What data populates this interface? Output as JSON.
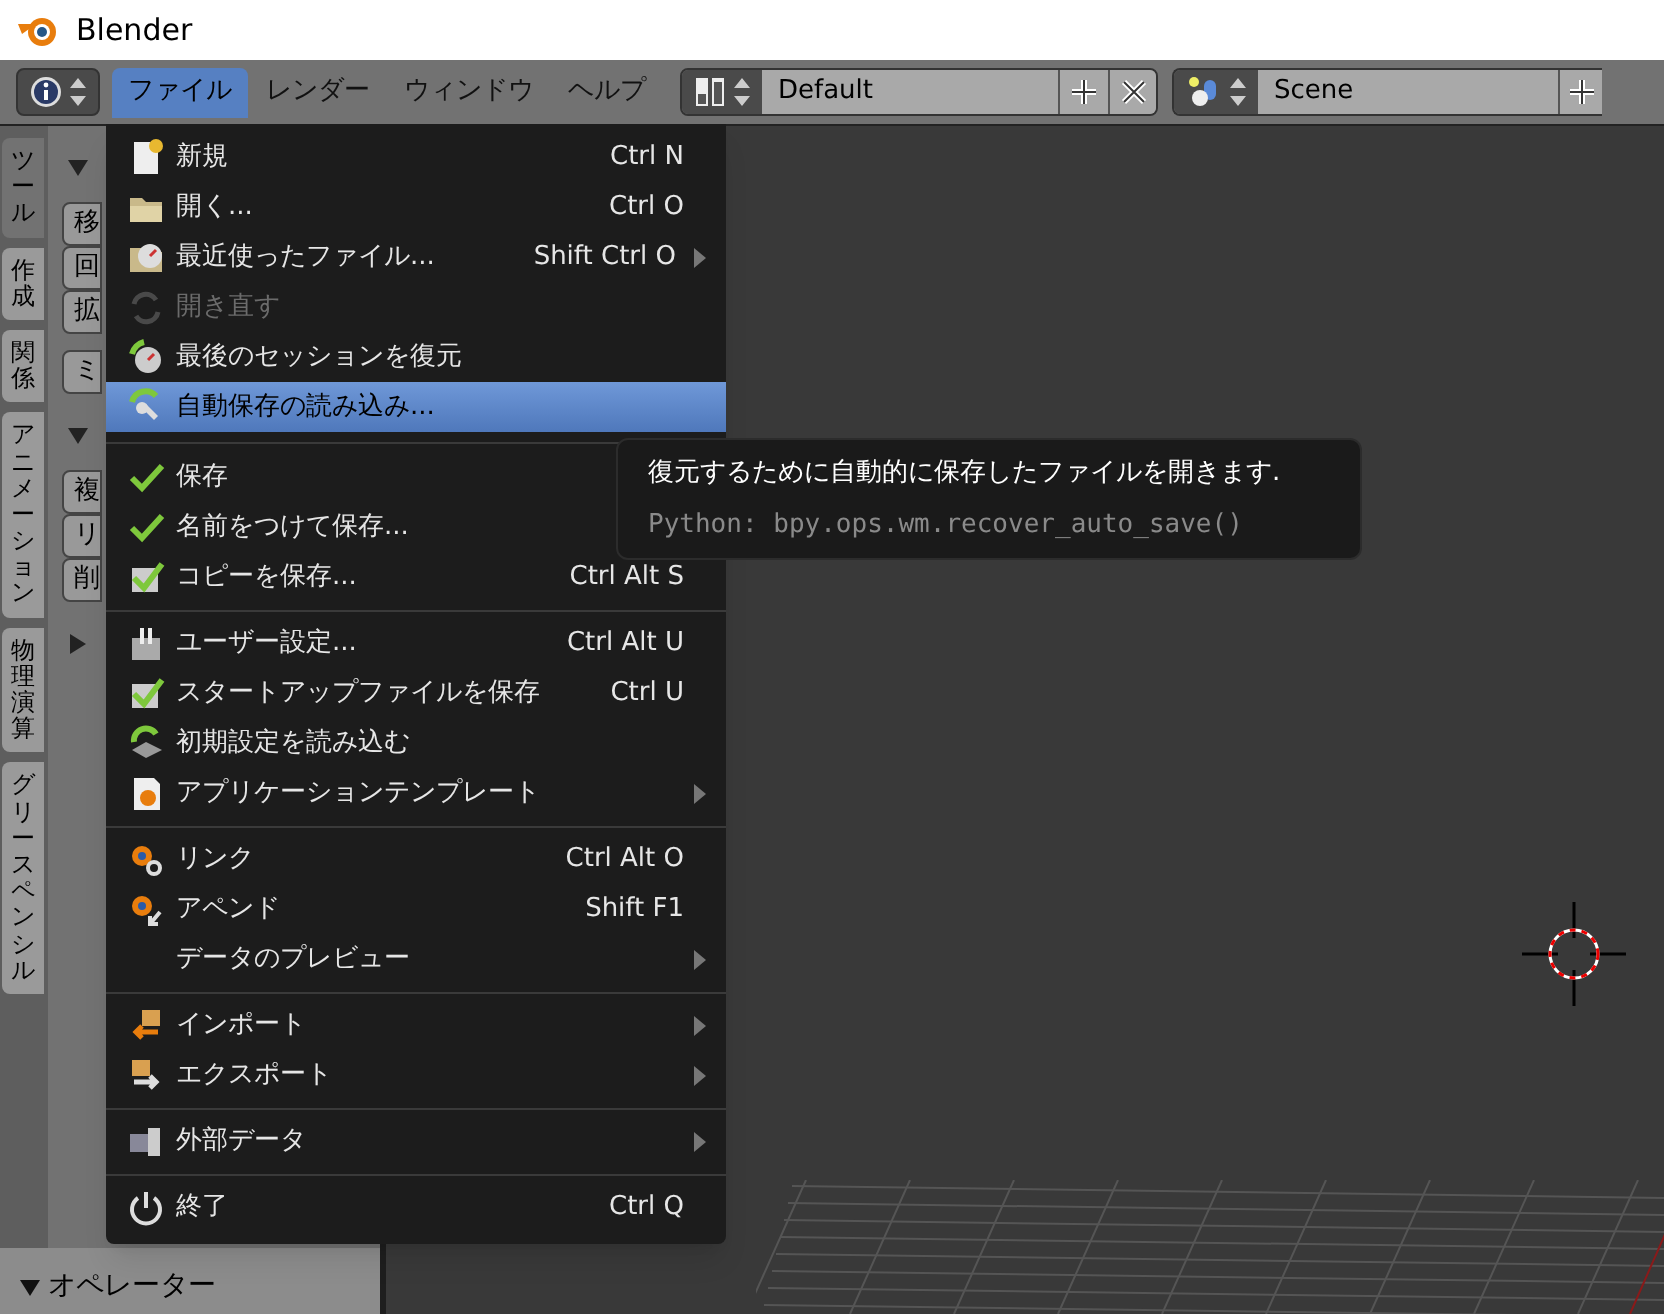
{
  "window": {
    "title": "Blender"
  },
  "header": {
    "menus": [
      {
        "label": "ファイル",
        "selected": true
      },
      {
        "label": "レンダー",
        "selected": false
      },
      {
        "label": "ウィンドウ",
        "selected": false
      },
      {
        "label": "ヘルプ",
        "selected": false
      }
    ],
    "layout": {
      "value": "Default"
    },
    "scene": {
      "value": "Scene"
    }
  },
  "tool_panel": {
    "tabs": [
      {
        "label": "ツール",
        "selected": true
      },
      {
        "label": "作成",
        "selected": false
      },
      {
        "label": "関係",
        "selected": false
      },
      {
        "label": "アニメーション",
        "selected": false
      },
      {
        "label": "物理演算",
        "selected": false
      },
      {
        "label": "グリースペンシル",
        "selected": false
      }
    ],
    "groups": [
      {
        "kind": "header",
        "expanded": true
      },
      {
        "kind": "buttons",
        "labels": [
          "移",
          "回",
          "拡"
        ]
      },
      {
        "kind": "buttons",
        "labels": [
          "ミ"
        ]
      },
      {
        "kind": "header",
        "expanded": true
      },
      {
        "kind": "buttons",
        "labels": [
          "複",
          "リ",
          "削"
        ]
      },
      {
        "kind": "header",
        "expanded": false
      }
    ],
    "footer": {
      "label": "オペレーター",
      "expanded": true
    }
  },
  "file_menu": {
    "sections": [
      [
        {
          "label": "新規",
          "shortcut": "Ctrl N",
          "submenu": false,
          "disabled": false,
          "selected": false
        },
        {
          "label": "開く...",
          "shortcut": "Ctrl O",
          "submenu": false,
          "disabled": false,
          "selected": false
        },
        {
          "label": "最近使ったファイル...",
          "shortcut": "Shift Ctrl O",
          "submenu": true,
          "disabled": false,
          "selected": false
        },
        {
          "label": "開き直す",
          "submenu": false,
          "disabled": true,
          "selected": false
        },
        {
          "label": "最後のセッションを復元",
          "submenu": false,
          "disabled": false,
          "selected": false
        },
        {
          "label": "自動保存の読み込み...",
          "submenu": false,
          "disabled": false,
          "selected": true
        }
      ],
      [
        {
          "label": "保存",
          "disabled": false,
          "selected": false
        },
        {
          "label": "名前をつけて保存...",
          "disabled": false,
          "selected": false
        },
        {
          "label": "コピーを保存...",
          "shortcut": "Ctrl Alt S",
          "submenu": false,
          "disabled": false,
          "selected": false
        }
      ],
      [
        {
          "label": "ユーザー設定...",
          "shortcut": "Ctrl Alt U",
          "submenu": false,
          "disabled": false,
          "selected": false
        },
        {
          "label": "スタートアップファイルを保存",
          "shortcut": "Ctrl U",
          "submenu": false,
          "disabled": false,
          "selected": false
        },
        {
          "label": "初期設定を読み込む",
          "submenu": false,
          "disabled": false,
          "selected": false
        },
        {
          "label": "アプリケーションテンプレート",
          "submenu": true,
          "disabled": false,
          "selected": false
        }
      ],
      [
        {
          "label": "リンク",
          "shortcut": "Ctrl Alt O",
          "submenu": false,
          "disabled": false,
          "selected": false
        },
        {
          "label": "アペンド",
          "shortcut": "Shift F1",
          "submenu": false,
          "disabled": false,
          "selected": false
        },
        {
          "label": "データのプレビュー",
          "submenu": true,
          "disabled": false,
          "selected": false
        }
      ],
      [
        {
          "label": "インポート",
          "submenu": true,
          "disabled": false,
          "selected": false
        },
        {
          "label": "エクスポート",
          "submenu": true,
          "disabled": false,
          "selected": false
        }
      ],
      [
        {
          "label": "外部データ",
          "submenu": true,
          "disabled": false,
          "selected": false
        }
      ],
      [
        {
          "label": "終了",
          "shortcut": "Ctrl Q",
          "submenu": false,
          "disabled": false,
          "selected": false
        }
      ]
    ]
  },
  "tooltip": {
    "text": "復元するために自動的に保存したファイルを開きます.",
    "python": "Python: bpy.ops.wm.recover_auto_save()"
  }
}
